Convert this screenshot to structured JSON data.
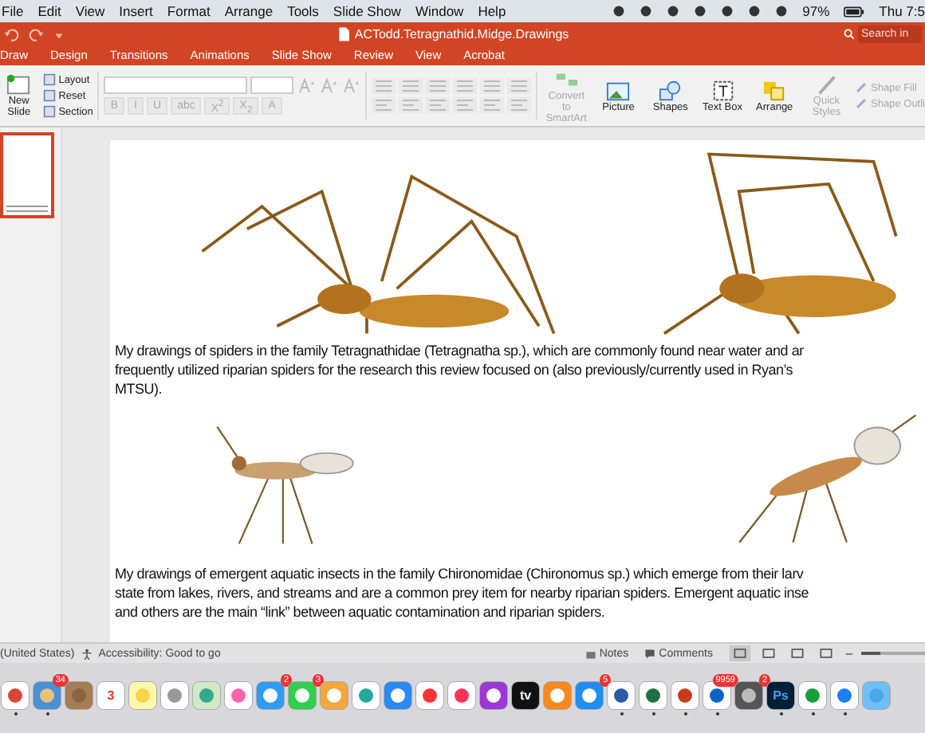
{
  "menu_bar": {
    "items": [
      "File",
      "Edit",
      "View",
      "Insert",
      "Format",
      "Arrange",
      "Tools",
      "Slide Show",
      "Window",
      "Help"
    ],
    "battery": "97%",
    "clock": "Thu 7:5"
  },
  "window": {
    "title": "ACTodd.Tetragnathid.Midge.Drawings",
    "search": {
      "placeholder": "Search in"
    }
  },
  "tabs": [
    "Draw",
    "Design",
    "Transitions",
    "Animations",
    "Slide Show",
    "Review",
    "View",
    "Acrobat"
  ],
  "ribbon": {
    "new_slide": "New Slide",
    "slide_buttons": [
      "Layout",
      "Reset",
      "Section"
    ],
    "format_buttons": [
      "B",
      "I",
      "U",
      "abc",
      "X$^{2}$",
      "X$_{2}$",
      "A"
    ],
    "insert_buttons": [
      {
        "label": "Convert to SmartArt",
        "kind": "smartart",
        "disabled": true
      },
      {
        "label": "Picture",
        "kind": "picture",
        "disabled": false
      },
      {
        "label": "Shapes",
        "kind": "shapes",
        "disabled": false
      },
      {
        "label": "Text Box",
        "kind": "textbox",
        "disabled": false
      },
      {
        "label": "Arrange",
        "kind": "arrange",
        "disabled": false
      },
      {
        "label": "Quick Styles",
        "kind": "styles",
        "disabled": true
      }
    ],
    "shape_buttons": [
      {
        "label": "Shape Fill",
        "disabled": true
      },
      {
        "label": "Shape Outli",
        "disabled": true
      }
    ]
  },
  "thumbnails": [
    {
      "selected": true
    }
  ],
  "slide": {
    "paragraphs": [
      {
        "lines": [
          "My drawings of spiders in the family Tetragnathidae (Tetragnatha sp.), which are commonly found near water and ar",
          "frequently utilized riparian spiders for the research this review focused on (also previously/currently used in Ryan’s",
          "MTSU)."
        ]
      },
      {
        "lines": [
          "My drawings of emergent aquatic insects in the family Chironomidae (Chironomus sp.) which emerge from their larv",
          "state from lakes, rivers, and streams and are a common prey item for nearby riparian spiders. Emergent aquatic inse",
          "and others are the main “link” between aquatic contamination and riparian spiders."
        ]
      }
    ]
  },
  "status_bar": {
    "language": "(United States)",
    "accessibility": "Accessibility: Good to go",
    "notes": "Notes",
    "comments": "Comments",
    "views": [
      {
        "selected": true
      },
      {
        "selected": false
      },
      {
        "selected": false
      },
      {
        "selected": false
      }
    ],
    "zoom": {
      "level": 0.3
    }
  },
  "dock": [
    {
      "running": true
    },
    {
      "badge": "34",
      "running": true
    },
    {
      "running": false
    },
    {
      "glyph": "3",
      "running": false
    },
    {
      "running": false
    },
    {
      "running": false
    },
    {
      "running": false
    },
    {
      "running": false
    },
    {
      "badge": "2",
      "running": false
    },
    {
      "badge": "3",
      "running": false
    },
    {
      "running": false
    },
    {
      "running": false
    },
    {
      "running": false
    },
    {
      "running": false
    },
    {
      "running": false
    },
    {
      "running": false
    },
    {
      "glyph": "tv",
      "running": false
    },
    {
      "running": false
    },
    {
      "badge": "5",
      "running": false
    },
    {
      "running": true
    },
    {
      "running": true
    },
    {
      "running": true
    },
    {
      "badge": "9959",
      "running": true
    },
    {
      "badge": "2",
      "running": false
    },
    {
      "glyph": "Ps",
      "running": true
    },
    {
      "running": true
    },
    {
      "running": true
    },
    {
      "running": false
    }
  ]
}
